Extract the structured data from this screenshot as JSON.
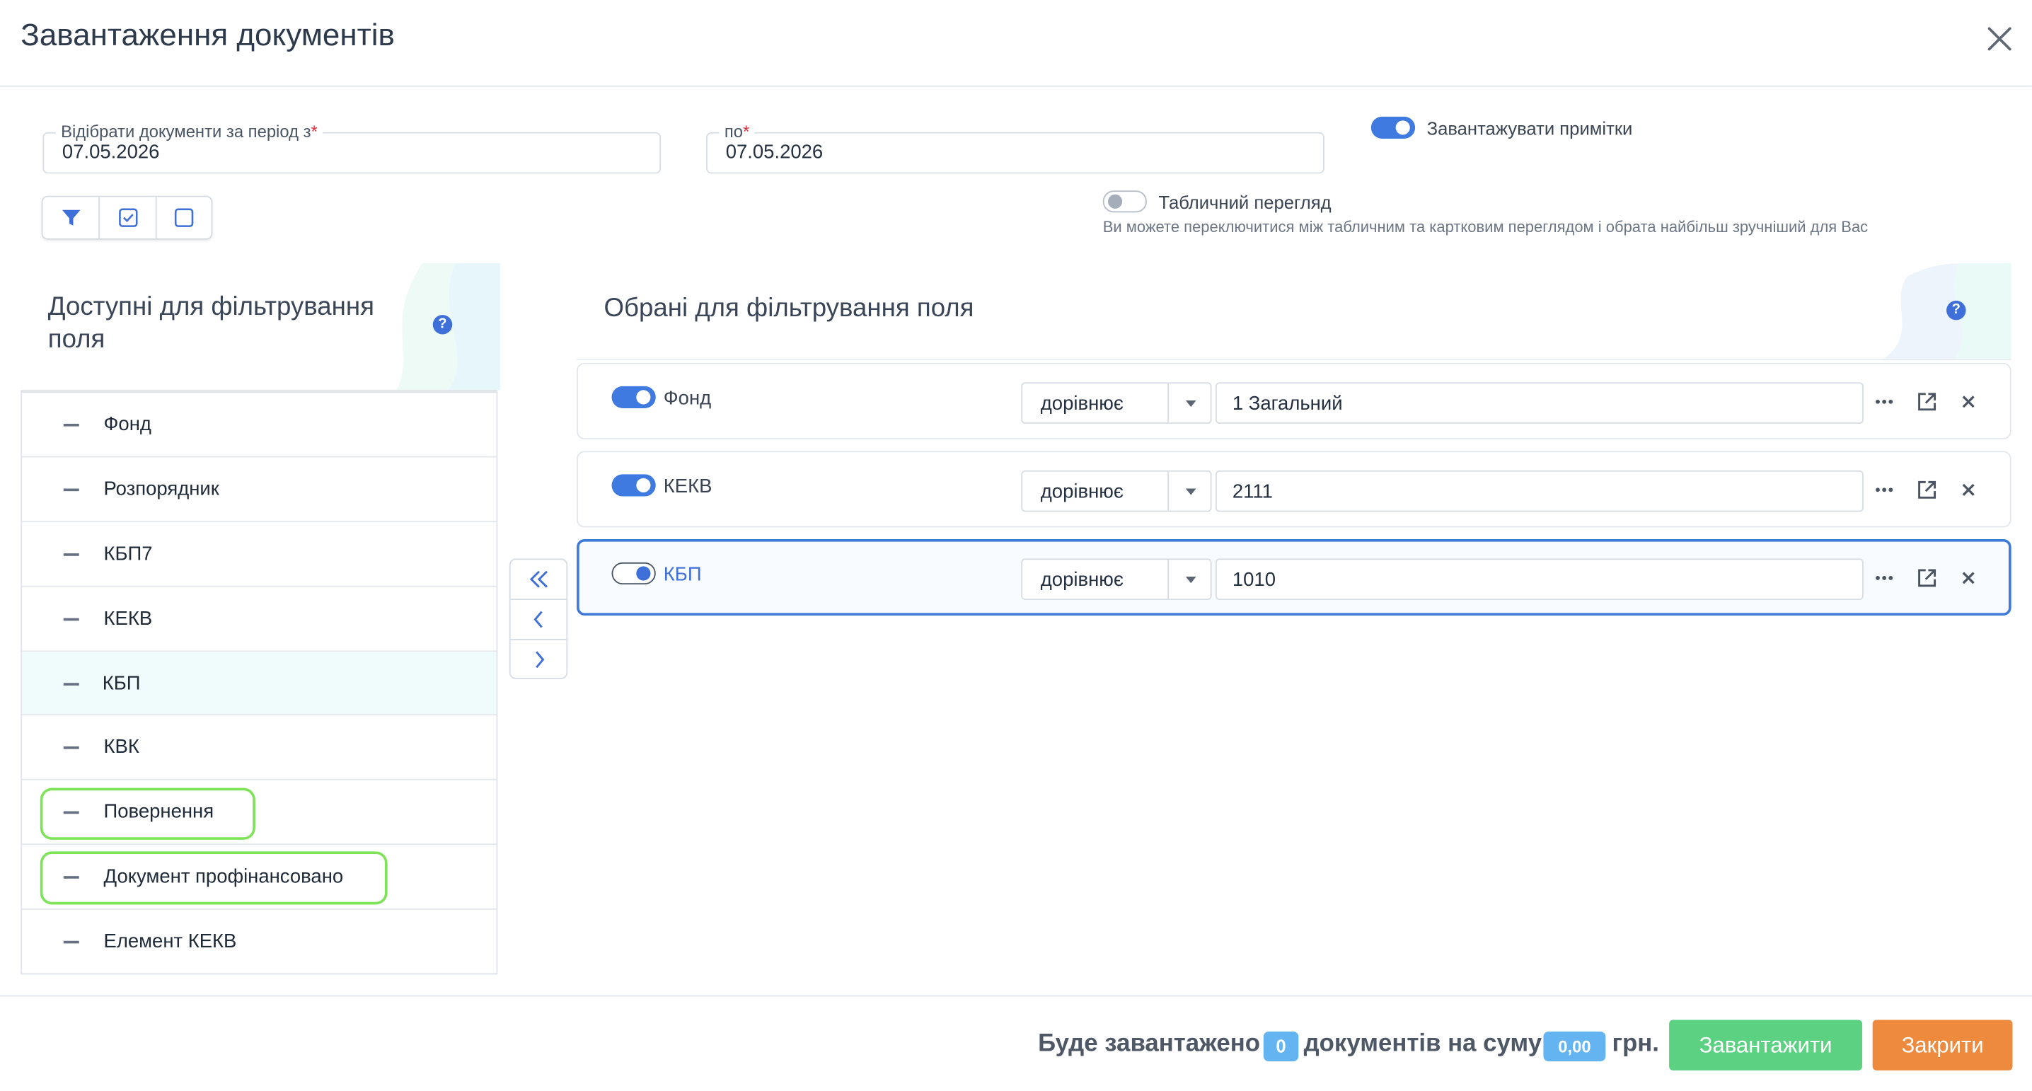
{
  "dialog": {
    "title": "Завантаження документів"
  },
  "period": {
    "from_label": "Відібрати документи за період з",
    "from_value": "07.05.2026",
    "to_label": "по",
    "to_value": "07.05.2026",
    "required_mark": "*"
  },
  "options": {
    "load_notes_label": "Завантажувати примітки",
    "load_notes_on": true,
    "table_view_label": "Табличний перегляд",
    "table_view_on": false,
    "table_view_hint": "Ви можете переключитися між табличним та картковим переглядом і обрата найбільш зручніший для Вас"
  },
  "available": {
    "heading_line1": "Доступні для фільтрування",
    "heading_line2": "поля",
    "help": "?",
    "items": [
      {
        "label": "Фонд"
      },
      {
        "label": "Розпорядник"
      },
      {
        "label": "КБП7"
      },
      {
        "label": "КЕКВ"
      },
      {
        "label": "КБП",
        "selected": true
      },
      {
        "label": "КВК"
      },
      {
        "label": "Повернення",
        "highlighted": true
      },
      {
        "label": "Документ профінансовано",
        "highlighted": true
      },
      {
        "label": "Елемент КЕКВ"
      }
    ]
  },
  "selected": {
    "heading": "Обрані для фільтрування поля",
    "help": "?",
    "rows": [
      {
        "name": "Фонд",
        "on": true,
        "operator": "дорівнює",
        "value": "1 Загальний"
      },
      {
        "name": "КЕКВ",
        "on": true,
        "operator": "дорівнює",
        "value": "2111"
      },
      {
        "name": "КБП",
        "on": true,
        "operator": "дорівнює",
        "value": "1010",
        "active": true
      }
    ]
  },
  "footer": {
    "will_load": "Буде завантажено",
    "count": "0",
    "docs_sum": "документів на суму",
    "sum": "0,00",
    "currency": "грн.",
    "load_button": "Завантажити",
    "close_button": "Закрити"
  },
  "colors": {
    "accent_blue": "#3f7ae0",
    "load_green": "#5cd182",
    "close_orange": "#ee8a3e",
    "highlight_green": "#7fe35a",
    "badge_blue": "#63b4f1"
  }
}
